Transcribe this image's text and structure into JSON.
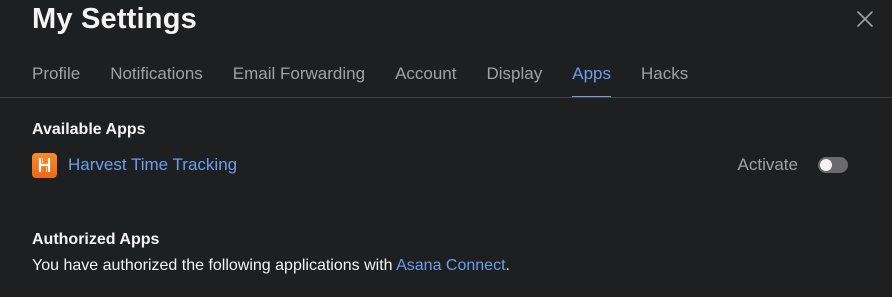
{
  "dialog": {
    "title": "My Settings",
    "close_icon": "close-icon"
  },
  "tabs": [
    {
      "label": "Profile",
      "active": false
    },
    {
      "label": "Notifications",
      "active": false
    },
    {
      "label": "Email Forwarding",
      "active": false
    },
    {
      "label": "Account",
      "active": false
    },
    {
      "label": "Display",
      "active": false
    },
    {
      "label": "Apps",
      "active": true
    },
    {
      "label": "Hacks",
      "active": false
    }
  ],
  "available_apps": {
    "heading": "Available Apps",
    "items": [
      {
        "name": "Harvest Time Tracking",
        "icon": "harvest-app-icon",
        "icon_letter": "H",
        "activate_label": "Activate",
        "activated": false
      }
    ]
  },
  "authorized_apps": {
    "heading": "Authorized Apps",
    "text_before": "You have authorized the following applications with ",
    "link": "Asana Connect",
    "text_after": "."
  },
  "colors": {
    "background": "#1e1f21",
    "accent": "#6d9ee8",
    "muted_text": "#a2a0a2",
    "harvest_orange": "#f5791f"
  }
}
